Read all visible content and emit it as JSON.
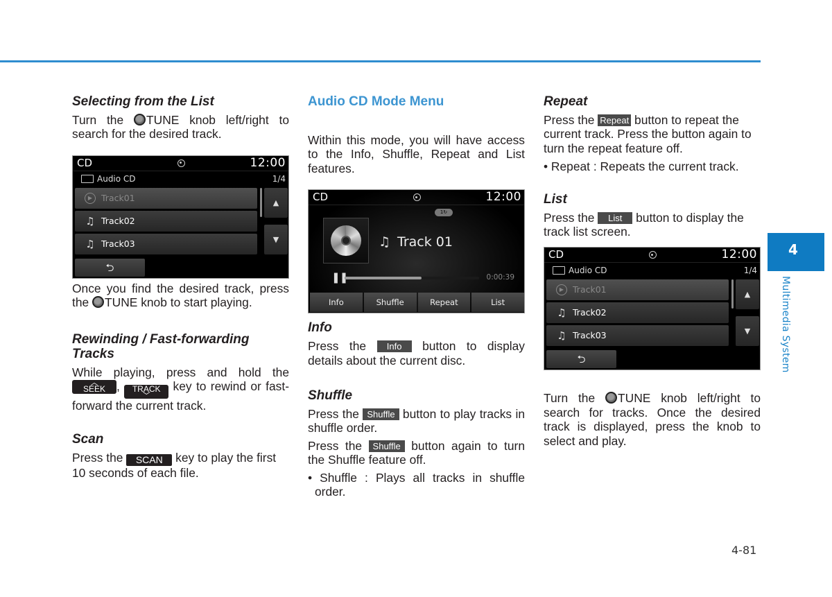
{
  "page": {
    "chapter_number": "4",
    "chapter_title": "Multimedia System",
    "page_number": "4-81",
    "accent_color": "#2e8ccf"
  },
  "col1": {
    "selecting": {
      "heading": "Selecting from the List",
      "p1_pre": "Turn the ",
      "p1_knob": "TUNE",
      "p1_post": " knob left/right to search for the desired track.",
      "p2_pre": "Once you find the desired track, press the ",
      "p2_knob": "TUNE",
      "p2_post": " knob to start playing."
    },
    "rewind": {
      "heading": "Rewinding / Fast-forwarding Tracks",
      "p_pre": "While playing, press and hold the ",
      "seek_key": "SEEK",
      "seek_caret": "^",
      "sep": ", ",
      "track_key": "TRACK",
      "track_caret": "v",
      "p_post": " key to rewind or fast-forward the current track."
    },
    "scan": {
      "heading": "Scan",
      "p_pre": "Press the ",
      "key": "SCAN",
      "p_post": " key to play the first 10 seconds of each file."
    }
  },
  "list_screen": {
    "mode": "CD",
    "clock": "12:00",
    "folder": "Audio CD",
    "page": "1/4",
    "tracks": [
      {
        "name": "Track01",
        "icon": "play-icon",
        "glyph": "▶"
      },
      {
        "name": "Track02",
        "icon": "music-note-icon",
        "glyph": "♫"
      },
      {
        "name": "Track03",
        "icon": "music-note-icon",
        "glyph": "♫"
      }
    ],
    "up_glyph": "▲",
    "down_glyph": "▼",
    "back_glyph": "⮌"
  },
  "col2": {
    "heading": "Audio CD Mode Menu",
    "intro": "Within this mode, you will have access to the Info, Shuffle, Repeat and List features.",
    "info": {
      "heading": "Info",
      "p_pre": "Press the ",
      "btn": "Info",
      "p_post": " button to display details about the current disc."
    },
    "shuffle": {
      "heading": "Shuffle",
      "p1_pre": "Press the ",
      "p1_btn": "Shuffle",
      "p1_post": " button to play tracks in shuffle order.",
      "p2_pre": "Press the ",
      "p2_btn": "Shuffle",
      "p2_post": " button again to turn the Shuffle feature off.",
      "bullet": "• Shuffle : Plays all tracks in shuffle order."
    }
  },
  "play_screen": {
    "mode": "CD",
    "clock": "12:00",
    "repeat_badge": "1↻",
    "track_title": "Track 01",
    "note_glyph": "♫",
    "pause_glyph": "❚❚",
    "elapsed": "0:00:39",
    "progress_percent": 57,
    "menu": [
      "Info",
      "Shuffle",
      "Repeat",
      "List"
    ]
  },
  "col3": {
    "repeat": {
      "heading": "Repeat",
      "p_pre": "Press the ",
      "btn": "Repeat",
      "p_post": " button to repeat the current track. Press the button again to turn the repeat feature off.",
      "bullet": "• Repeat : Repeats the current track."
    },
    "list": {
      "heading": "List",
      "p_pre": "Press the ",
      "btn": "List",
      "p_post": " button to display the track list screen."
    },
    "tune": {
      "p_pre": "Turn the ",
      "knob": "TUNE",
      "p_post": " knob left/right to search for tracks. Once the desired track is displayed, press the knob to select and play."
    }
  }
}
